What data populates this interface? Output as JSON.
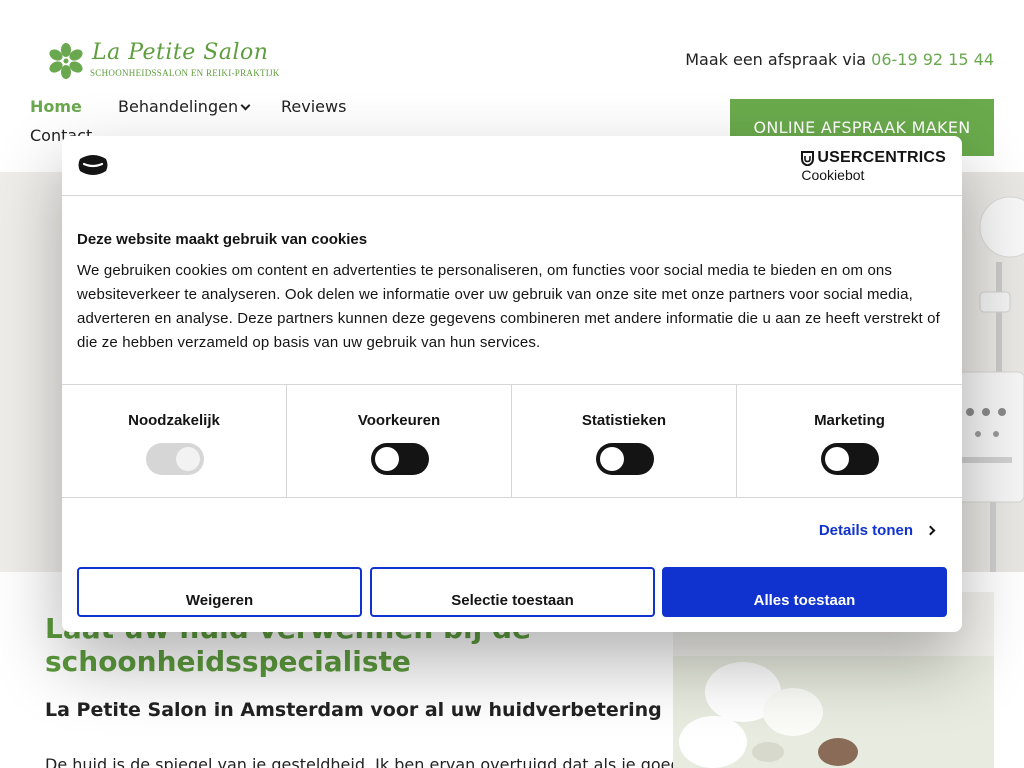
{
  "site": {
    "logo_name": "La Petite Salon",
    "logo_tagline": "SCHOONHEIDSSALON EN REIKI-PRAKTIJK",
    "appointment_prefix": "Maak een afspraak via",
    "phone": "06-19 92 15 44",
    "nav": [
      {
        "label": "Home",
        "active": true
      },
      {
        "label": "Behandelingen",
        "has_dropdown": true
      },
      {
        "label": "Reviews"
      },
      {
        "label": "Contact"
      }
    ],
    "cta_label": "ONLINE AFSPRAAK MAKEN",
    "hero_heading": "Laat uw huid verwennen bij de schoonheidsspecialiste",
    "subheading": "La Petite Salon in Amsterdam voor al uw huidverbetering",
    "body_start": "De huid is de spiegel van je gesteldheid. Ik ben ervan overtuigd dat als je goed",
    "accent_color": "#6aa84f"
  },
  "cookie_dialog": {
    "brand_line1": "USERCENTRICS",
    "brand_line2": "Cookiebot",
    "title": "Deze website maakt gebruik van cookies",
    "text": "We gebruiken cookies om content en advertenties te personaliseren, om functies voor social media te bieden en om ons websiteverkeer te analyseren. Ook delen we informatie over uw gebruik van onze site met onze partners voor social media, adverteren en analyse. Deze partners kunnen deze gegevens combineren met andere informatie die u aan ze heeft verstrekt of die ze hebben verzameld op basis van uw gebruik van hun services.",
    "categories": [
      {
        "label": "Noodzakelijk",
        "checked": true,
        "disabled": true
      },
      {
        "label": "Voorkeuren",
        "checked": false,
        "disabled": false
      },
      {
        "label": "Statistieken",
        "checked": false,
        "disabled": false
      },
      {
        "label": "Marketing",
        "checked": false,
        "disabled": false
      }
    ],
    "details_label": "Details tonen",
    "buttons": {
      "deny": "Weigeren",
      "selection": "Selectie toestaan",
      "allow_all": "Alles toestaan"
    },
    "accent_color": "#1032cf"
  }
}
